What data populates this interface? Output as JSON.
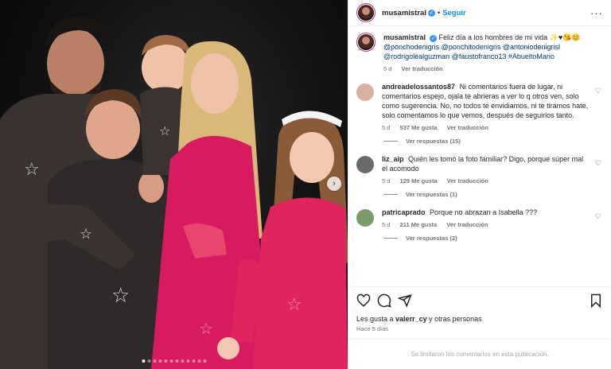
{
  "post": {
    "username": "musamistral",
    "follow_label": "Seguir",
    "separator": "•",
    "more_label": "···",
    "caption_text": "Feliz día a los hombres de mi vida ✨♥😘😊",
    "caption_tags": "@ponchodenigris @ponchitodenigris @antoniodenigrisl @rodrigolealguzman @faustofranco13 #AbueltoMario",
    "caption_time": "5 d",
    "caption_translate": "Ver traducción"
  },
  "comments": [
    {
      "user": "andreadelossantos87",
      "text": "Ni comentarios fuera de lugar, ni comentarios espejo, ojala te abrieras a ver lo q otros ven, solo como sugerencia. No, no todos te envidiamos, ni te tiramos hate, solo comentamos lo que vemos, después de seguirlos tanto.",
      "time": "5 d",
      "likes": "537 Me gusta",
      "translate": "Ver traducción",
      "replies": "Ver respuestas (15)",
      "avatar_color": "#d8b0a0"
    },
    {
      "user": "liz_aip",
      "text": "Quién les tomó la foto familiar? Digo, porque súper mal el acomodo",
      "time": "5 d",
      "likes": "129 Me gusta",
      "translate": "Ver traducción",
      "replies": "Ver respuestas (1)",
      "avatar_color": "#6a6a6a"
    },
    {
      "user": "patricaprado",
      "text": "Porque no abrazan a Isabella ???",
      "time": "5 d",
      "likes": "211 Me gusta",
      "translate": "Ver traducción",
      "replies": "Ver respuestas (2)",
      "avatar_color": "#7d9a6a"
    }
  ],
  "footer": {
    "likes_prefix": "Les gusta a ",
    "likes_user": "valerr_cy",
    "likes_suffix": " y otras personas",
    "time_ago": "Hace 5 días",
    "limited_text": "Se limitaron los comentarios en esta publicación."
  },
  "carousel": {
    "next_label": "›",
    "count": 12,
    "active_index": 0
  },
  "colors": {
    "accent": "#0095f6",
    "verified": "#3897f0",
    "pajama_pink": "#d81b60",
    "pajama_dark": "#2b2b2b"
  }
}
